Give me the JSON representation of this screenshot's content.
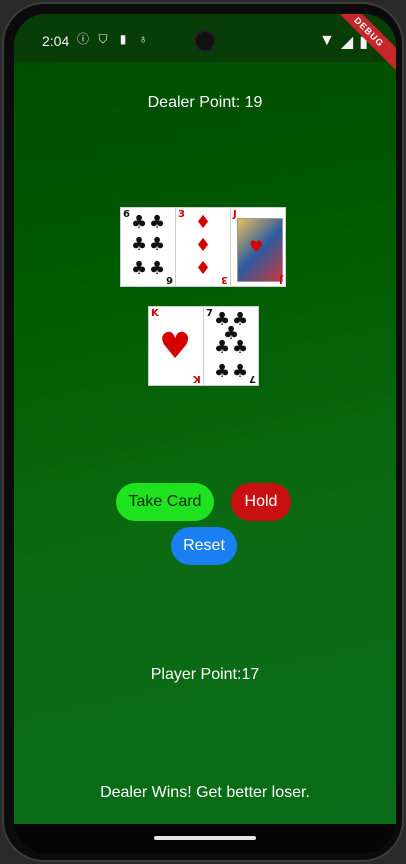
{
  "status_bar": {
    "time": "2:04",
    "left_icons": [
      "info-icon",
      "shield-icon",
      "sim-icon",
      "mic-icon"
    ],
    "right_icons": [
      "wifi-icon",
      "signal-icon",
      "battery-icon"
    ],
    "debug_banner": "DEBUG"
  },
  "game": {
    "dealer_label": "Dealer Point: 19",
    "dealer_cards": [
      {
        "rank": "6",
        "suit": "♣",
        "color": "black"
      },
      {
        "rank": "3",
        "suit": "♦",
        "color": "red"
      },
      {
        "rank": "J",
        "suit": "♥",
        "color": "red"
      }
    ],
    "player_cards": [
      {
        "rank": "K",
        "suit": "♥",
        "color": "red"
      },
      {
        "rank": "7",
        "suit": "♣",
        "color": "black"
      }
    ],
    "buttons": {
      "take_card": "Take Card",
      "hold": "Hold",
      "reset": "Reset"
    },
    "player_label": "Player Point:17",
    "result": "Dealer Wins! Get better loser."
  },
  "colors": {
    "take_card_bg": "#1ee31e",
    "hold_bg": "#c81010",
    "reset_bg": "#1a7ff0",
    "table_bg": "#005a00"
  }
}
